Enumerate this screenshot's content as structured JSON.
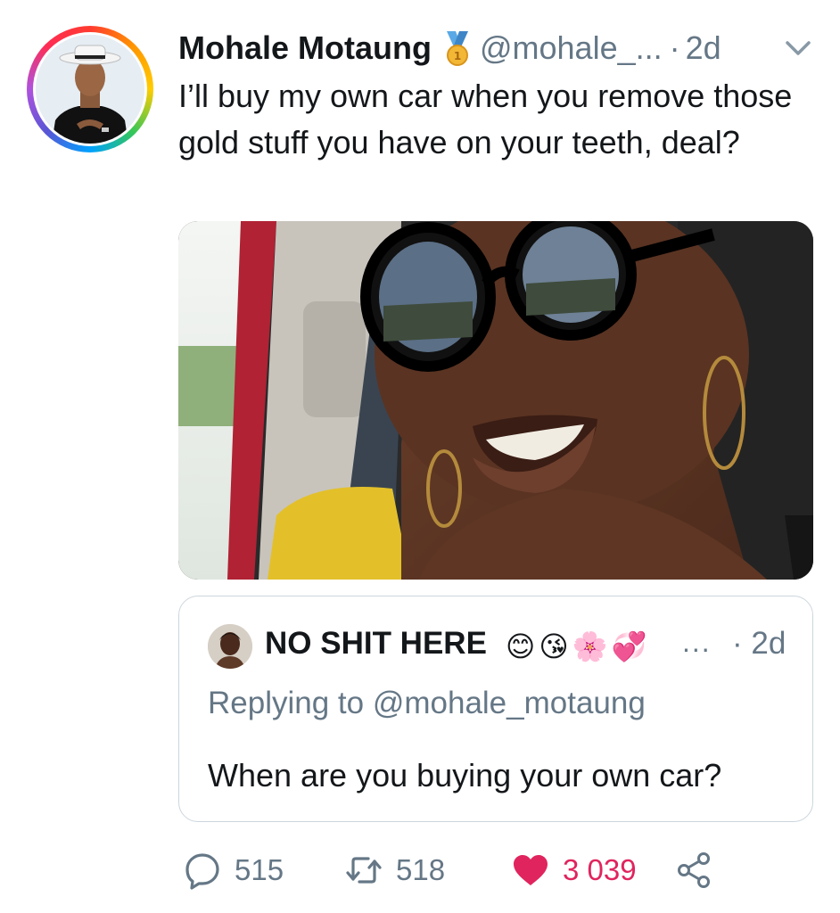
{
  "tweet": {
    "author_name": "Mohale Motaung",
    "author_handle": "@mohale_...",
    "separator": "·",
    "time": "2d",
    "badge_icon": "medal-icon",
    "text": "I’ll buy my own car when you remove those gold stuff you have on your teeth, deal?"
  },
  "quoted_tweet": {
    "author_name": "NO SHIT HERE",
    "emojis": [
      "😊",
      "😘",
      "🌸",
      "💞"
    ],
    "ellipsis": "...",
    "separator": "·",
    "time": "2d",
    "replying_to": "Replying to @mohale_motaung",
    "text": "When are you buying your own car?"
  },
  "actions": {
    "reply_count": "515",
    "retweet_count": "518",
    "like_count": "3 039"
  },
  "colors": {
    "text": "#14171a",
    "secondary": "#657786",
    "like": "#e0245e",
    "border": "#ccd6dd"
  }
}
